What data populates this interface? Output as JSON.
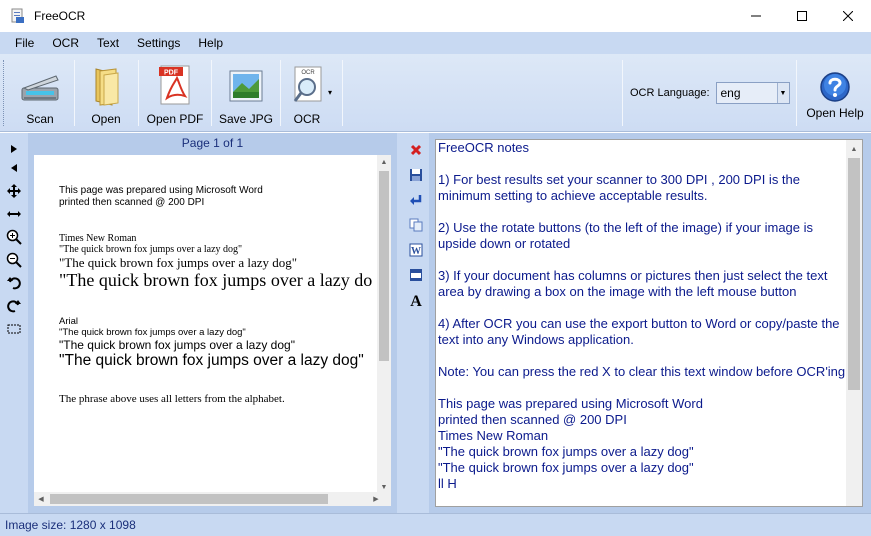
{
  "window": {
    "title": "FreeOCR"
  },
  "menu": [
    "File",
    "OCR",
    "Text",
    "Settings",
    "Help"
  ],
  "toolbar": {
    "scan": "Scan",
    "open": "Open",
    "open_pdf": "Open PDF",
    "save_jpg": "Save JPG",
    "ocr": "OCR",
    "ocr_language_label": "OCR Language:",
    "ocr_language_value": "eng",
    "open_help": "Open Help",
    "pdf_badge": "PDF",
    "ocr_badge": "OCR"
  },
  "image_pane": {
    "page_label": "Page 1 of 1",
    "lines": {
      "l1": "This page was prepared using Microsoft Word",
      "l2": "printed then scanned @ 200 DPI",
      "l3": "Times New Roman",
      "l4": "\"The quick brown fox jumps over a lazy dog\"",
      "l5": "\"The quick brown fox jumps over a lazy dog\"",
      "l6": "\"The quick brown fox jumps over a lazy do",
      "l7": "Arial",
      "l8": "\"The quick brown fox jumps over a lazy dog\"",
      "l9": "\"The quick brown fox  jumps over a lazy dog\"",
      "l10": "\"The quick brown fox jumps over a lazy dog\"",
      "l11": "The phrase above uses all letters from the alphabet."
    }
  },
  "text_pane": {
    "content": "FreeOCR notes\n\n1) For best results set your scanner to 300 DPI , 200 DPI is the minimum setting to achieve acceptable results.\n\n2) Use the rotate buttons (to the left of the image) if your image is upside down or rotated\n\n3) If your document has columns or pictures then just select the text area by drawing a box on the image with the left mouse button\n\n4) After OCR you can use the export button to Word or copy/paste the text into any Windows application.\n\nNote: You can press the red X to clear this text window before OCR'ing\n\nThis page was prepared using Microsoft Word\nprinted then scanned @ 200 DPI\nTimes New Roman\n\"The quick brown fox jumps over a lazy dog\"\n\"The quick brown fox jumps over a lazy dog\"\nll H"
  },
  "status": {
    "image_size": "Image size:  1280 x  1098"
  },
  "colors": {
    "accent": "#c8d9f2",
    "text_blue": "#0b1a8c",
    "panel": "#b6cbea"
  }
}
